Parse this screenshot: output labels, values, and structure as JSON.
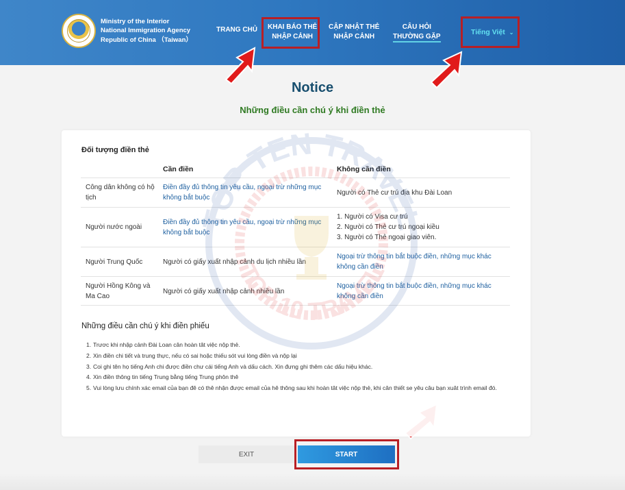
{
  "header": {
    "agency_line1": "Ministry of the Interior",
    "agency_line2": "National Immigration Agency",
    "agency_line3": "Republic of China （Taiwan）",
    "nav": {
      "home": "TRANG CHỦ",
      "declare_line1": "KHAI BÁO THẺ",
      "declare_line2": "NHẬP CẢNH",
      "update_line1": "CẬP NHẬT THẺ",
      "update_line2": "NHẬP CẢNH",
      "faq_line1": "CÂU HỎI",
      "faq_line2": "THƯỜNG GẶP",
      "language": "Tiếng Việt"
    },
    "icons": {
      "logo": "agency-seal-icon",
      "lang_chevron": "chevron-down-icon"
    }
  },
  "page": {
    "title": "Notice",
    "subtitle": "Những điều cần chú ý khi điền thẻ"
  },
  "section1": {
    "title": "Đối tượng điền thẻ",
    "columns": [
      "Cần điền",
      "Không cần điền"
    ],
    "rows": [
      {
        "who": "Công dân không có hộ tịch",
        "need": "Điền đầy đủ thông tin yêu cầu, ngoại trừ những mục không bắt buộc",
        "noneed": "Người có Thẻ cư trú địa khu Đài Loan"
      },
      {
        "who": "Người nước ngoài",
        "need": "Điền đầy đủ thông tin yêu cầu, ngoại trừ những mục không bắt buộc",
        "noneed_lines": [
          "1. Người có Visa cư trú",
          "2. Người có Thẻ cư trú ngoại kiều",
          "3. Người có Thẻ ngoại giao viên."
        ]
      },
      {
        "who": "Người Trung Quốc",
        "need": "Người có giấy xuất nhập cảnh du lịch nhiều lần",
        "noneed": "Ngoại trừ thông tin bắt buộc điền, những mục khác không cần điền"
      },
      {
        "who": "Người Hồng Kông và Ma Cao",
        "need": "Người có giấy xuất nhập cảnh nhiều lần",
        "noneed": "Ngoại trừ thông tin bắt buộc điền, những mục khác không cần điền"
      }
    ]
  },
  "section2": {
    "title": "Những điều cần chú ý khi điền phiếu",
    "notes": [
      "Trươc khi nhập cảnh Đài Loan cân hoàn tât việc nộp thẻ.",
      "Xin điền chi tiết và trung thực, nếu có sai hoặc thiếu sót vui lòng điền và nộp lại",
      "Coi ghi tên họ tiếng Anh chi được điền chư cái tiếng Anh và dấu cách. Xin đưng ghi thêm các dấu hiệu khác.",
      "Xin điền thông tin tiếng Trung bằng tiếng Trung phôn thê",
      "Vui lòng lưu chính xác email của bạn đê có thê nhận được email của hê thông sau khi hoàn tât việc nộp thẻ, khi cân thiết se yêu câu bạn xuât trình email đó."
    ]
  },
  "buttons": {
    "exit": "EXIT",
    "start": "START"
  },
  "watermark": {
    "text_top": "TOP TEN TRAVEL",
    "text_bottom": "TOP 10 TRAVEL"
  },
  "colors": {
    "header_start": "#3f86c9",
    "header_end": "#1f5fa8",
    "title": "#174e6e",
    "subtitle": "#2f7a22",
    "link_blue": "#1d5f9f",
    "highlight_red": "#b81f25",
    "lang_cyan": "#62e0f0",
    "start_button": "#1e6fc2"
  }
}
